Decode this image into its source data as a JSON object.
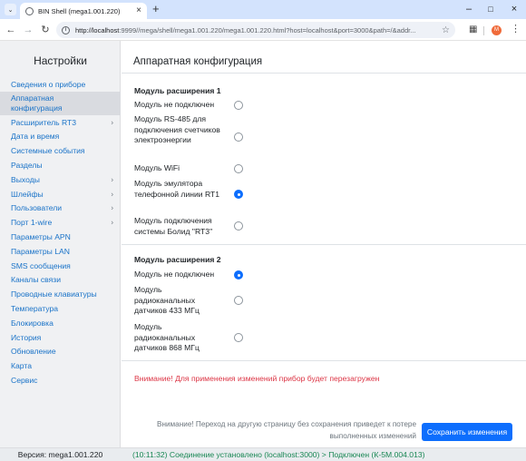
{
  "browser": {
    "tab_title": "BIN Shell (mega1.001.220)",
    "url_host": "http://localhost",
    "url_rest": ":9999//mega/shell/mega1.001.220/mega1.001.220.html?host=localhost&port=3000&path=/&addr...",
    "avatar_letter": "M"
  },
  "sidebar": {
    "title": "Настройки",
    "items": [
      {
        "label": "Сведения о приборе",
        "chevron": false,
        "active": false
      },
      {
        "label": "Аппаратная конфигурация",
        "chevron": false,
        "active": true
      },
      {
        "label": "Расширитель RT3",
        "chevron": true,
        "active": false
      },
      {
        "label": "Дата и время",
        "chevron": false,
        "active": false
      },
      {
        "label": "Системные события",
        "chevron": false,
        "active": false
      },
      {
        "label": "Разделы",
        "chevron": false,
        "active": false
      },
      {
        "label": "Выходы",
        "chevron": true,
        "active": false
      },
      {
        "label": "Шлейфы",
        "chevron": true,
        "active": false
      },
      {
        "label": "Пользователи",
        "chevron": true,
        "active": false
      },
      {
        "label": "Порт 1-wire",
        "chevron": true,
        "active": false
      },
      {
        "label": "Параметры APN",
        "chevron": false,
        "active": false
      },
      {
        "label": "Параметры LAN",
        "chevron": false,
        "active": false
      },
      {
        "label": "SMS сообщения",
        "chevron": false,
        "active": false
      },
      {
        "label": "Каналы связи",
        "chevron": false,
        "active": false
      },
      {
        "label": "Проводные клавиатуры",
        "chevron": false,
        "active": false
      },
      {
        "label": "Температура",
        "chevron": false,
        "active": false
      },
      {
        "label": "Блокировка",
        "chevron": false,
        "active": false
      },
      {
        "label": "История",
        "chevron": false,
        "active": false
      },
      {
        "label": "Обновление",
        "chevron": false,
        "active": false
      },
      {
        "label": "Карта",
        "chevron": false,
        "active": false
      },
      {
        "label": "Сервис",
        "chevron": false,
        "active": false
      }
    ]
  },
  "main": {
    "title": "Аппаратная конфигурация",
    "module1": {
      "title": "Модуль расширения 1",
      "options": [
        {
          "label": "Модуль не подключен",
          "selected": false
        },
        {
          "label": "Модуль RS-485 для подключения счетчиков электроэнергии",
          "selected": false
        },
        {
          "label": "Модуль WiFi",
          "selected": false
        },
        {
          "label": "Модуль эмулятора телефонной линии RT1",
          "selected": true
        },
        {
          "label": "Модуль подключения системы Болид \"RT3\"",
          "selected": false
        }
      ]
    },
    "module2": {
      "title": "Модуль расширения 2",
      "options": [
        {
          "label": "Модуль не подключен",
          "selected": true
        },
        {
          "label": "Модуль радиоканальных датчиков 433 МГц",
          "selected": false
        },
        {
          "label": "Модуль радиоканальных датчиков 868 МГц",
          "selected": false
        }
      ]
    },
    "warning": "Внимание! Для применения изменений прибор будет перезагружен",
    "save_note_line1": "Внимание! Переход на другую страницу без сохранения приведет к потере",
    "save_note_line2": "выполненных изменений",
    "save_label": "Сохранить изменения"
  },
  "status": {
    "version": "Версия: mega1.001.220",
    "connection": "(10:11:32) Соединение установлено (localhost:3000) > Подключен (К-5М.004.013)"
  },
  "colors": {
    "link": "#1a73c8",
    "primary": "#0d6efd",
    "danger": "#dc3545",
    "success": "#198754"
  }
}
